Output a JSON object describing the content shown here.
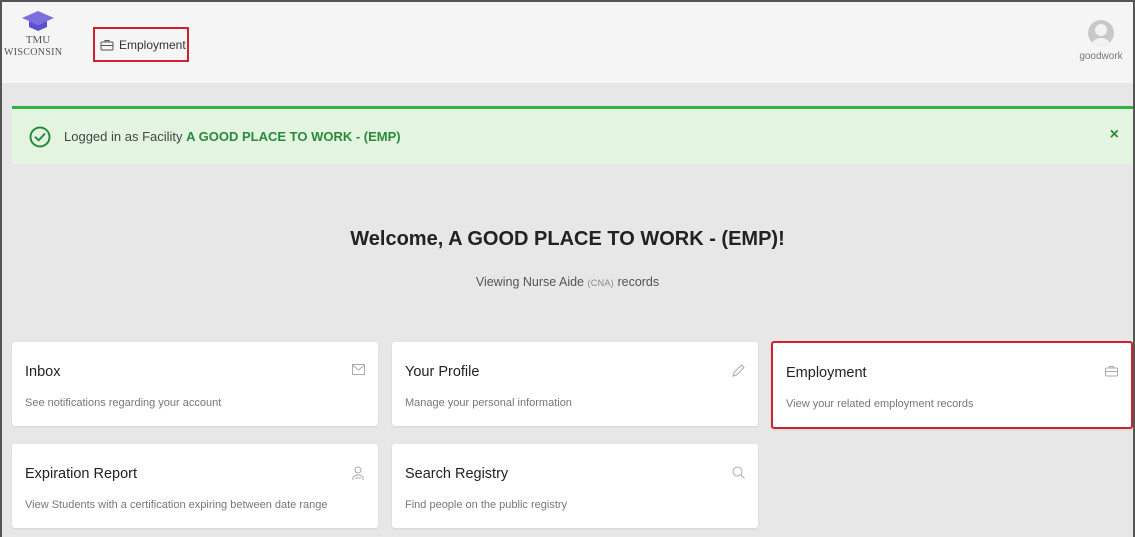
{
  "logo": {
    "line1": "TMU",
    "line2": "WISCONSIN"
  },
  "nav": {
    "employment_label": "Employment"
  },
  "user": {
    "name": "goodwork"
  },
  "alert": {
    "prefix": "Logged in as Facility ",
    "facility": "A GOOD PLACE TO WORK - (EMP)",
    "close": "×"
  },
  "welcome": {
    "title": "Welcome, A GOOD PLACE TO WORK - (EMP)!",
    "sub_before": "Viewing Nurse Aide ",
    "sub_tag": "(CNA)",
    "sub_after": " records"
  },
  "cards": [
    {
      "title": "Inbox",
      "desc": "See notifications regarding your account",
      "icon": "envelope-icon"
    },
    {
      "title": "Your Profile",
      "desc": "Manage your personal information",
      "icon": "pencil-icon"
    },
    {
      "title": "Employment",
      "desc": "View your related employment records",
      "icon": "briefcase-icon"
    },
    {
      "title": "Expiration Report",
      "desc": "View Students with a certification expiring between date range",
      "icon": "users-icon"
    },
    {
      "title": "Search Registry",
      "desc": "Find people on the public registry",
      "icon": "search-icon"
    }
  ],
  "colors": {
    "highlight": "#d0212f",
    "success": "#2fb344",
    "alert_bg": "#e3f5e1",
    "logo_purple": "#6a5acd"
  }
}
